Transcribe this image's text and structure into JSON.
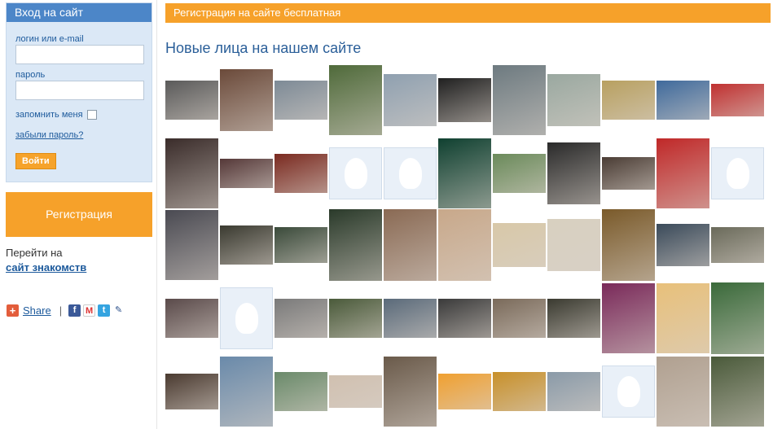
{
  "login": {
    "title": "Вход на сайт",
    "login_label": "логин или e-mail",
    "login_value": "",
    "password_label": "пароль",
    "password_value": "",
    "remember_label": "запомнить меня",
    "forgot_label": "забыли пароль?",
    "submit_label": "Войти"
  },
  "register_label": "Регистрация",
  "goto": {
    "text": "Перейти на",
    "link": "сайт знакомств"
  },
  "share": {
    "label": "Share",
    "separator": "|",
    "icons": [
      "facebook-icon",
      "gmail-icon",
      "twitter-icon",
      "edit-icon"
    ]
  },
  "banner": "Регистрация на сайте бесплатная",
  "section_title": "Новые лица на нашем сайте",
  "colors": {
    "accent_orange": "#f6a12a",
    "login_blue": "#4c86c8",
    "login_bg": "#dbe8f6",
    "link_blue": "#1d5a9c"
  },
  "faces": [
    [
      {
        "c": "#5a5a5a"
      },
      {
        "c": "#6b4a3a"
      },
      {
        "c": "#7d8a96"
      },
      {
        "c": "#4f6a3a"
      },
      {
        "c": "#8fa0b0"
      },
      {
        "c": "#202020"
      },
      {
        "c": "#6d7a80"
      },
      {
        "c": "#9aa8a0"
      },
      {
        "c": "#b8a060"
      },
      {
        "c": "#3f6a9c"
      },
      {
        "c": "#c03030"
      }
    ],
    [
      {
        "c": "#3a2c2a"
      },
      {
        "c": "#553838"
      },
      {
        "c": "#7a2a20"
      },
      {
        "blank": true
      },
      {
        "blank": true
      },
      {
        "c": "#0f4030"
      },
      {
        "c": "#6a8a5a"
      },
      {
        "c": "#2a2a2a"
      },
      {
        "c": "#4a3c34"
      },
      {
        "c": "#c02828"
      },
      {
        "blank": true
      }
    ],
    [
      {
        "c": "#4a4a52"
      },
      {
        "c": "#3a3a30"
      },
      {
        "c": "#3a4a3a"
      },
      {
        "c": "#2a3a2a"
      },
      {
        "c": "#8a6a54"
      },
      {
        "c": "#c8a88a"
      },
      {
        "c": "#d8c8a8"
      },
      {
        "c": "#d8d0c0"
      },
      {
        "c": "#7a5a2a"
      },
      {
        "c": "#3a4a5a"
      },
      {
        "c": "#6a6a5a"
      }
    ],
    [
      {
        "c": "#5a4a4a"
      },
      {
        "blank": true
      },
      {
        "c": "#7a7a7a"
      },
      {
        "c": "#4a5a3a"
      },
      {
        "c": "#5a6a7a"
      },
      {
        "c": "#3a3a3a"
      },
      {
        "c": "#7a6a5a"
      },
      {
        "c": "#3a3a30"
      },
      {
        "c": "#7a2a5a"
      },
      {
        "c": "#e8c07a"
      },
      {
        "c": "#3a6a3a"
      }
    ],
    [
      {
        "c": "#4a3a30"
      },
      {
        "c": "#6a8aaa"
      },
      {
        "c": "#6a8a6a"
      },
      {
        "c": "#d0c0b0"
      },
      {
        "c": "#6a5a4a"
      },
      {
        "c": "#f0a030"
      },
      {
        "c": "#c8902a"
      },
      {
        "c": "#8a9aa8"
      },
      {
        "blank": true
      },
      {
        "c": "#b0a090"
      },
      {
        "c": "#4a5a3a"
      }
    ]
  ]
}
